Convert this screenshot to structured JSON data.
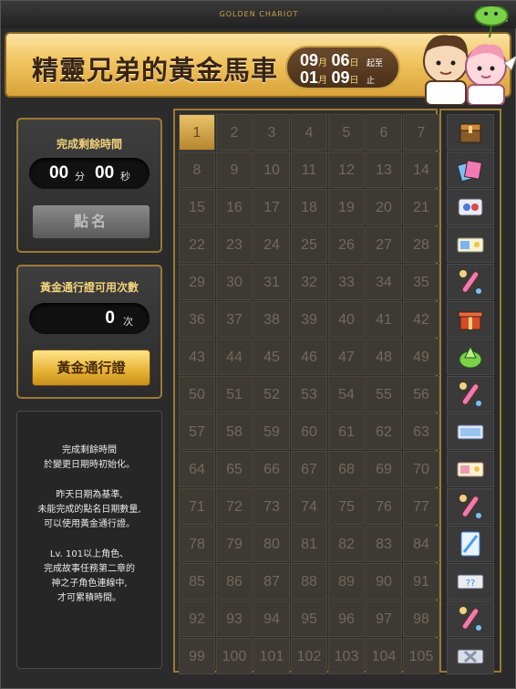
{
  "window": {
    "title": "GOLDEN CHARIOT",
    "help_label": "?",
    "close_label": "×"
  },
  "banner": {
    "title": "精靈兄弟的黃金馬車",
    "start": {
      "month": "09",
      "month_unit": "月",
      "day": "06",
      "day_unit": "日",
      "tag": "起至"
    },
    "end": {
      "month": "01",
      "month_unit": "月",
      "day": "09",
      "day_unit": "日",
      "tag": "止"
    }
  },
  "timer": {
    "label": "完成剩餘時間",
    "minutes": "00",
    "minutes_unit": "分",
    "seconds": "00",
    "seconds_unit": "秒",
    "button": "點名"
  },
  "pass": {
    "label": "黃金通行證可用次數",
    "count": "0",
    "count_unit": "次",
    "button": "黃金通行證"
  },
  "info": {
    "p1": [
      "完成剩餘時間",
      "於變更日期時初始化。"
    ],
    "p2": [
      "昨天日期為基準,",
      "未能完成的點名日期數量,",
      "可以使用黃金通行證。"
    ],
    "p3": [
      "Lv. 101以上角色、",
      "完成故事任務第二章的",
      "神之子角色連線中,",
      "才可累積時間。"
    ]
  },
  "grid": {
    "current_day": "1",
    "days": [
      "1",
      "2",
      "3",
      "4",
      "5",
      "6",
      "7",
      "8",
      "9",
      "10",
      "11",
      "12",
      "13",
      "14",
      "15",
      "16",
      "17",
      "18",
      "19",
      "20",
      "21",
      "22",
      "23",
      "24",
      "25",
      "26",
      "27",
      "28",
      "29",
      "30",
      "31",
      "32",
      "33",
      "34",
      "35",
      "36",
      "37",
      "38",
      "39",
      "40",
      "41",
      "42",
      "43",
      "44",
      "45",
      "46",
      "47",
      "48",
      "49",
      "50",
      "51",
      "52",
      "53",
      "54",
      "55",
      "56",
      "57",
      "58",
      "59",
      "60",
      "61",
      "62",
      "63",
      "64",
      "65",
      "66",
      "67",
      "68",
      "69",
      "70",
      "71",
      "72",
      "73",
      "74",
      "75",
      "76",
      "77",
      "78",
      "79",
      "80",
      "81",
      "82",
      "83",
      "84",
      "85",
      "86",
      "87",
      "88",
      "89",
      "90",
      "91",
      "92",
      "93",
      "94",
      "95",
      "96",
      "97",
      "98",
      "99",
      "100",
      "101",
      "102",
      "103",
      "104",
      "105"
    ]
  },
  "rewards": [
    {
      "icon": "treasure-box-icon"
    },
    {
      "icon": "card-pack-icon"
    },
    {
      "icon": "toggle-ticket-icon"
    },
    {
      "icon": "coupon-icon"
    },
    {
      "icon": "magic-scroll-icon"
    },
    {
      "icon": "gift-box-icon"
    },
    {
      "icon": "green-crystal-icon"
    },
    {
      "icon": "magic-scroll-icon"
    },
    {
      "icon": "coupon-blue-icon"
    },
    {
      "icon": "coupon-gold-icon"
    },
    {
      "icon": "magic-scroll-icon"
    },
    {
      "icon": "blue-card-icon"
    },
    {
      "icon": "question-ticket-icon"
    },
    {
      "icon": "magic-scroll-icon"
    },
    {
      "icon": "x-ticket-icon"
    }
  ]
}
